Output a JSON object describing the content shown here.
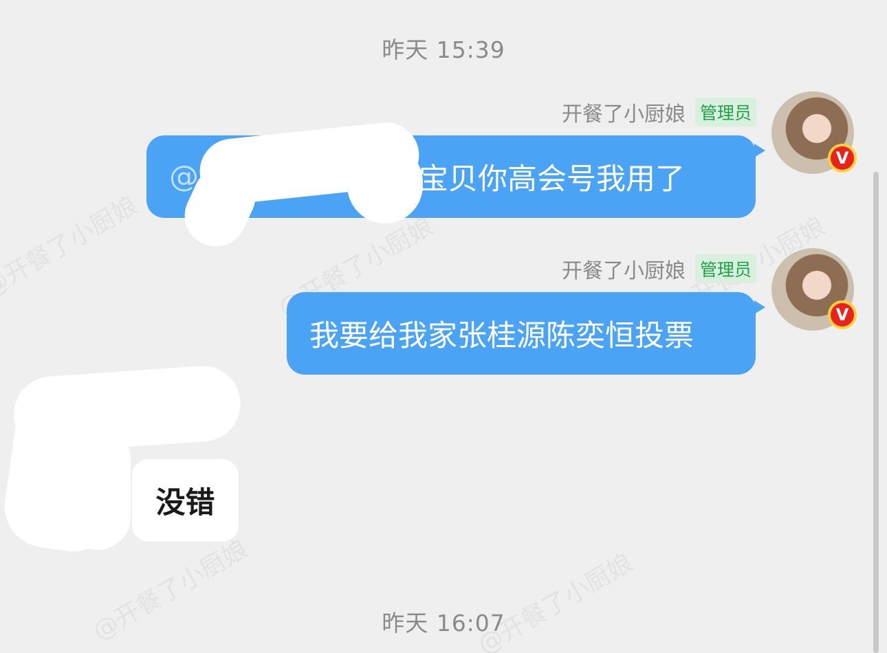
{
  "timestamps": [
    "昨天 15:39",
    "昨天 16:07"
  ],
  "messages": [
    {
      "sender": "开餐了小厨娘",
      "role": "管理员",
      "mention": "@",
      "text": "宝贝你高会号我用了"
    },
    {
      "sender": "开餐了小厨娘",
      "role": "管理员",
      "text": "我要给我家张桂源陈奕恒投票"
    },
    {
      "text": "没错"
    }
  ],
  "vip_badge": "V",
  "watermark": "@开餐了小厨娘",
  "colors": {
    "background": "#efefef",
    "outgoing_bubble": "#4aa3f5",
    "incoming_bubble": "#ffffff",
    "admin_badge_bg": "#d9f0df",
    "admin_badge_text": "#21a04a",
    "vip_badge": "#e8231e"
  }
}
